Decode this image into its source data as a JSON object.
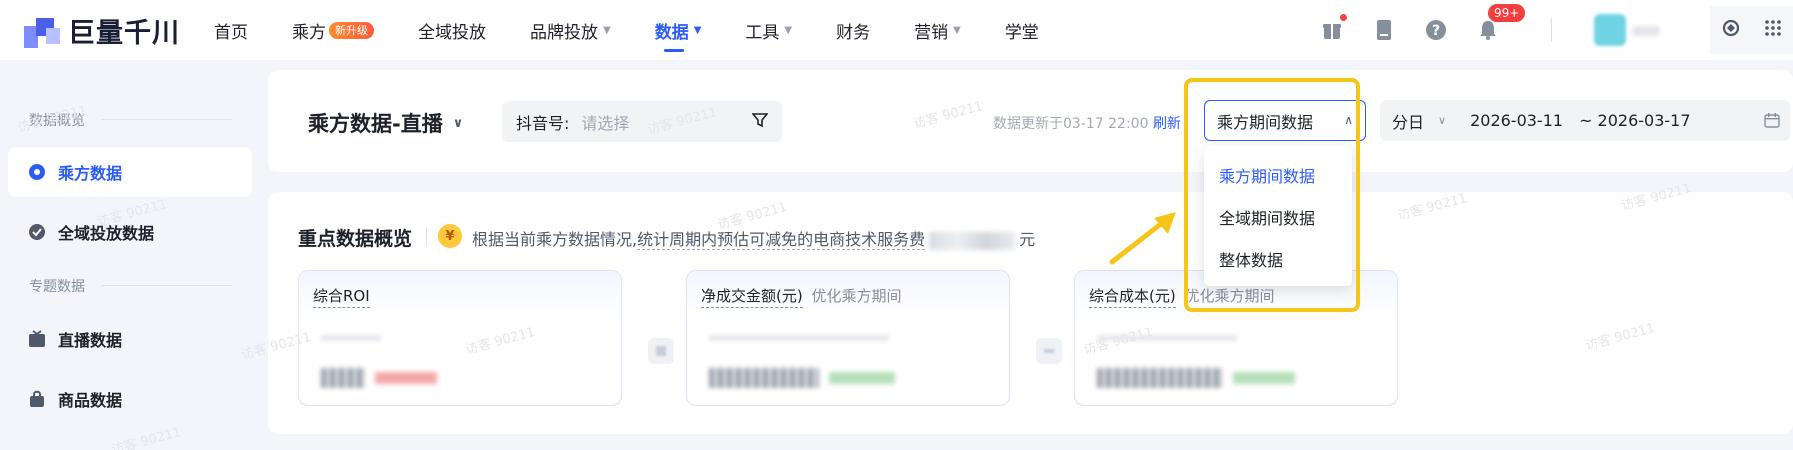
{
  "brand": {
    "name": "巨量千川"
  },
  "nav": {
    "items": [
      {
        "label": "首页"
      },
      {
        "label": "乘方",
        "badge": "新升级"
      },
      {
        "label": "全域投放"
      },
      {
        "label": "品牌投放",
        "has_dropdown": true
      },
      {
        "label": "数据",
        "has_dropdown": true,
        "active": true
      },
      {
        "label": "工具",
        "has_dropdown": true
      },
      {
        "label": "财务"
      },
      {
        "label": "营销",
        "has_dropdown": true
      },
      {
        "label": "学堂"
      }
    ],
    "notification_count": "99+",
    "icons": [
      "gift-icon",
      "document-icon",
      "help-icon",
      "bell-icon",
      "api-icon",
      "app-grid-icon"
    ]
  },
  "sidebar": {
    "section1_title": "数据概览",
    "section2_title": "专题数据",
    "items": [
      {
        "label": "乘方数据",
        "icon": "gear-badge-icon",
        "active": true
      },
      {
        "label": "全域投放数据",
        "icon": "check-circle-icon"
      },
      {
        "label": "直播数据",
        "icon": "tv-icon"
      },
      {
        "label": "商品数据",
        "icon": "bag-icon"
      }
    ]
  },
  "header": {
    "title": "乘方数据-直播",
    "account_label": "抖音号:",
    "account_placeholder": "请选择",
    "update_text": "数据更新于03-17 22:00",
    "refresh_label": "刷新",
    "period_value": "乘方期间数据",
    "granularity": "分日",
    "date_start": "2026-03-11",
    "date_end": "~ 2026-03-17"
  },
  "dropdown": {
    "options": [
      "乘方期间数据",
      "全域期间数据",
      "整体数据"
    ],
    "selected_index": 0
  },
  "overview": {
    "title": "重点数据概览",
    "coin_symbol": "¥",
    "desc_prefix": "根据当前乘方数据情况,",
    "desc_dashed": "统计周期内预估可减免的电商技术服务费",
    "desc_suffix": "元",
    "metrics": [
      {
        "label": "综合ROI",
        "sub": ""
      },
      {
        "label": "净成交金额(元)",
        "sub": "优化乘方期间"
      },
      {
        "label": "综合成本(元)",
        "sub": "优化乘方期间"
      }
    ]
  },
  "watermark": "访客 90211",
  "colors": {
    "accent": "#2b5cf5",
    "highlight": "#f5c518",
    "badge_red": "#f53f3f"
  }
}
